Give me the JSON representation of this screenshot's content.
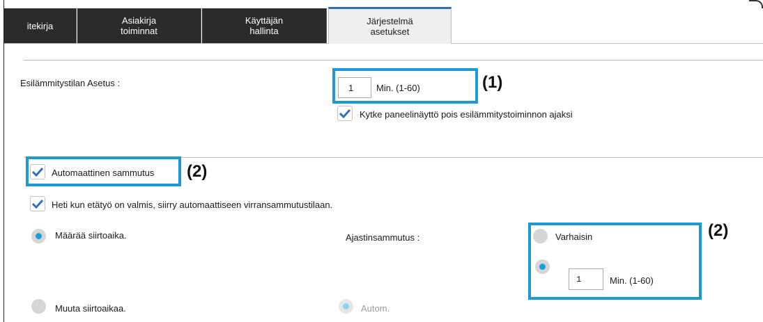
{
  "tabs": [
    {
      "label": "itekirja",
      "active": false
    },
    {
      "label": "Asiakirja\ntoiminnat",
      "active": false
    },
    {
      "label": "Käyttäjän\nhallinta",
      "active": false
    },
    {
      "label": "Järjestelmä\nasetukset",
      "active": true
    }
  ],
  "preheat": {
    "label": "Esilämmitystilan Asetus :",
    "value": "1",
    "unit": "Min. (1-60)",
    "panel_off_label": "Kytke paneelinäyttö pois esilämmitystoiminnon ajaksi",
    "panel_off_checked": true
  },
  "auto_shutdown": {
    "label": "Automaattinen sammutus",
    "checked": true,
    "immediate_label": "Heti kun etätyö on valmis, siirry automaattiseen virransammutustilaan.",
    "immediate_checked": true,
    "set_time_label": "Määrää siirtoaika.",
    "change_time_label": "Muuta siirtoaikaa.",
    "timer_label": "Ajastinsammutus :",
    "earliest_label": "Varhaisin",
    "timer_value": "1",
    "timer_unit": "Min. (1-60)",
    "autom_label": "Autom."
  },
  "markers": {
    "m1": "(1)",
    "m2a": "(2)",
    "m2b": "(2)"
  },
  "colors": {
    "callout": "#1b9ad6",
    "tab_dark": "#2b2b2b",
    "check": "#2f6fba",
    "radio_on": "#1aa0d8"
  }
}
